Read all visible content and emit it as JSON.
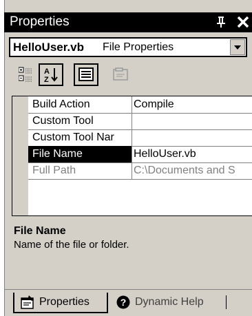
{
  "window": {
    "title": "Properties"
  },
  "selector": {
    "object_name": "HelloUser.vb",
    "object_type": "File Properties"
  },
  "grid": {
    "rows": [
      {
        "name": "Build Action",
        "value": "Compile"
      },
      {
        "name": "Custom Tool",
        "value": ""
      },
      {
        "name": "Custom Tool Nar",
        "value": ""
      },
      {
        "name": "File Name",
        "value": "HelloUser.vb"
      },
      {
        "name": "Full Path",
        "value": "C:\\Documents and S"
      }
    ]
  },
  "description": {
    "title": "File Name",
    "text": "Name of the file or folder."
  },
  "tabs": [
    {
      "label": "Properties",
      "icon": "properties-icon"
    },
    {
      "label": "Dynamic Help",
      "icon": "help-icon"
    }
  ],
  "icons": {
    "title_bar": [
      "pin-icon",
      "close-icon"
    ],
    "toolbar": [
      "categorized-icon",
      "alphabetical-icon",
      "properties-view-icon",
      "property-pages-icon"
    ]
  }
}
